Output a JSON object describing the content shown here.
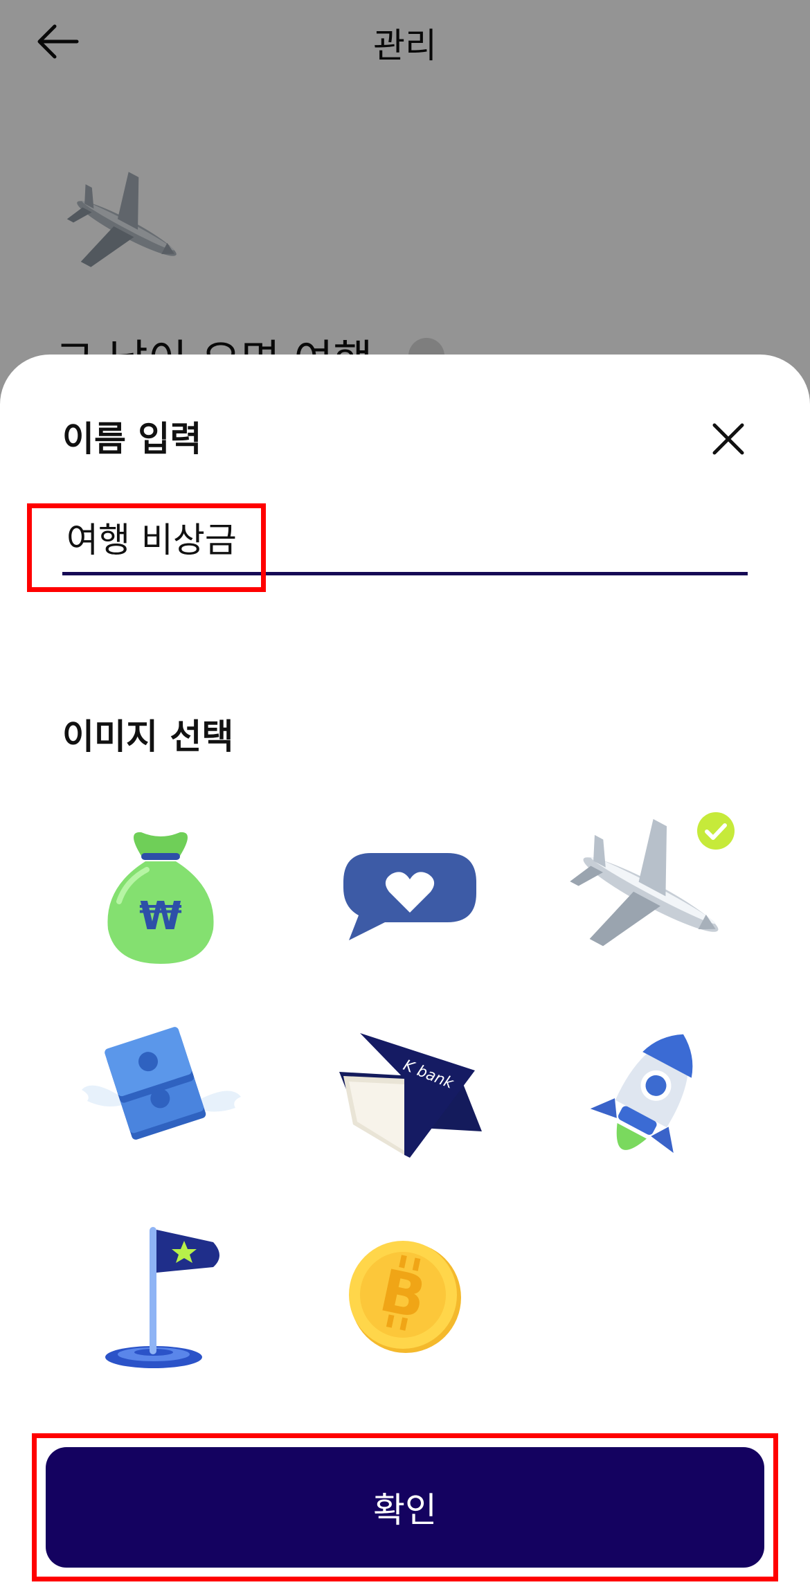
{
  "header": {
    "title": "관리"
  },
  "background": {
    "goal_name": "그 날이 오면 여행"
  },
  "sheet": {
    "title": "이름 입력",
    "name_input_value": "여행 비상금",
    "image_section_title": "이미지 선택",
    "images": [
      {
        "name": "money-bag",
        "selected": false
      },
      {
        "name": "heart-speech-bubble",
        "selected": false
      },
      {
        "name": "airplane",
        "selected": true
      },
      {
        "name": "winged-cash",
        "selected": false
      },
      {
        "name": "kbank-passbook",
        "selected": false
      },
      {
        "name": "rocket",
        "selected": false
      },
      {
        "name": "star-flag",
        "selected": false
      },
      {
        "name": "bitcoin-coin",
        "selected": false
      }
    ],
    "passbook_brand": "K bank",
    "confirm_label": "확인"
  },
  "icons": {
    "back": "arrow-left-icon",
    "close": "close-icon",
    "edit": "pencil-icon",
    "selected": "check-circle-icon"
  },
  "colors": {
    "primary": "#140260",
    "highlight": "#ff0000",
    "check_badge": "#c6ea3a"
  }
}
